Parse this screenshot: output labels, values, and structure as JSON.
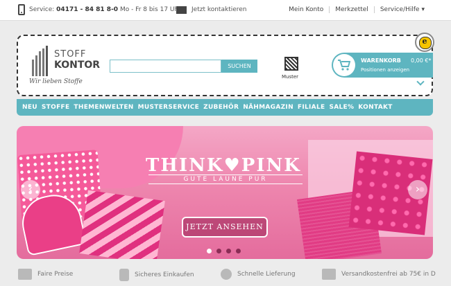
{
  "topbar": {
    "service_prefix": "Service:",
    "phone": "04171 - 84 81 8-0",
    "hours": "Mo - Fr 8 bis 17 Uhr",
    "contact": "Jetzt kontaktieren",
    "links": [
      "Mein Konto",
      "Merkzettel",
      "Service/Hilfe"
    ]
  },
  "header": {
    "logo_line1": "STOFF",
    "logo_line2": "KONTOR",
    "slogan": "Wir lieben Stoffe",
    "search_placeholder": "",
    "search_button": "SUCHEN",
    "muster_label": "Muster",
    "cart_title": "WARENKORB",
    "cart_total": "0,00 €*",
    "cart_action": "Positionen anzeigen",
    "seal_letter": "e"
  },
  "nav": [
    "NEU",
    "STOFFE",
    "THEMENWELTEN",
    "MUSTERSERVICE",
    "ZUBEHÖR",
    "NÄHMAGAZIN",
    "FILIALE",
    "SALE%",
    "KONTAKT"
  ],
  "banner": {
    "title_left": "THINK",
    "title_right": "PINK",
    "subtitle": "GUTE LAUNE PUR",
    "cta": "JETZT ANSEHEN",
    "slide_count": 4,
    "active_slide": 1
  },
  "usps": [
    "Faire Preise",
    "Sicheres Einkaufen",
    "Schnelle Lieferung",
    "Versandkostenfrei ab 75€ in D"
  ],
  "colors": {
    "accent": "#5eb5c0",
    "pink": "#e46c9d"
  }
}
